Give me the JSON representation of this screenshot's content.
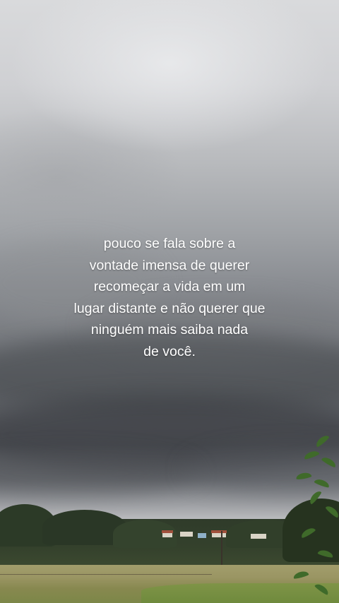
{
  "caption": {
    "lines": [
      "pouco se fala sobre a",
      "vontade imensa de querer",
      "recomeçar a vida em um",
      "lugar distante e não querer que",
      "ninguém mais saiba nada",
      "de você."
    ]
  },
  "colors": {
    "sky_top": "#d9dadc",
    "storm_cloud": "#4f5257",
    "trees": "#2c3a27",
    "field": "#9a9563",
    "text": "#ffffff"
  }
}
